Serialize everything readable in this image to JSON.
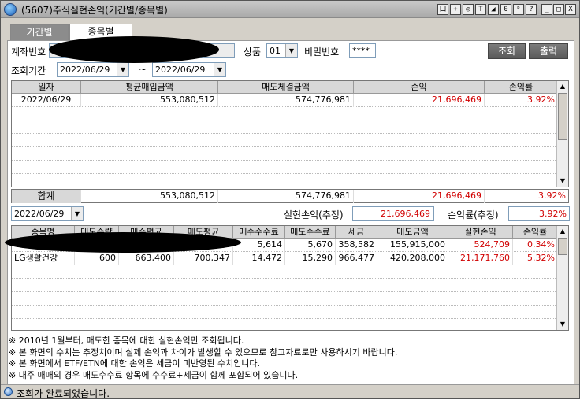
{
  "window": {
    "title": "(5607)주식실현손익(기간별/종목별)",
    "buttons": [
      "口",
      "+",
      "◎",
      "T",
      "◢",
      "0",
      "ᵖ",
      "?",
      "_",
      "□",
      "X"
    ]
  },
  "tabs": [
    {
      "label": "기간별"
    },
    {
      "label": "종목별"
    }
  ],
  "form": {
    "account_label": "계좌번호",
    "account_value": "",
    "product_label": "상품",
    "product_value": "01",
    "password_label": "비밀번호",
    "password_value": "****",
    "period_label": "조회기간",
    "start_date": "2022/06/29",
    "tilde": "~",
    "end_date": "2022/06/29",
    "query_button": "조회",
    "print_button": "출력"
  },
  "daily_table": {
    "headers": [
      "일자",
      "평균매입금액",
      "매도체결금액",
      "손익",
      "손익률"
    ],
    "rows": [
      [
        "2022/06/29",
        "553,080,512",
        "574,776,981",
        "21,696,469",
        "3.92%"
      ]
    ],
    "total_label": "합계",
    "total": [
      "553,080,512",
      "574,776,981",
      "21,696,469",
      "3.92%"
    ]
  },
  "summary": {
    "date": "2022/06/29",
    "realized_label": "실현손익(추정)",
    "realized_value": "21,696,469",
    "rate_label": "손익률(추정)",
    "rate_value": "3.92%"
  },
  "stock_table": {
    "headers": [
      "종목명",
      "매도수량",
      "매수평균",
      "매도평균",
      "매수수수료",
      "매도수수료",
      "세금",
      "매도금액",
      "실현손익",
      "손익률"
    ],
    "rows": [
      [
        "",
        "",
        "",
        "",
        "5,614",
        "5,670",
        "358,582",
        "155,915,000",
        "524,709",
        "0.34%"
      ],
      [
        "LG생활건강",
        "600",
        "663,400",
        "700,347",
        "14,472",
        "15,290",
        "966,477",
        "420,208,000",
        "21,171,760",
        "5.32%"
      ]
    ]
  },
  "notes": [
    "※ 2010년 1월부터, 매도한 종목에 대한 실현손익만 조회됩니다.",
    "※ 본 화면의 수치는 추정치이며 실제 손익과 차이가 발생할 수 있으므로 참고자료로만 사용하시기 바랍니다.",
    "※ 본 화면에서 ETF/ETN에 대한 손익은 세금이 미반영된 수치입니다.",
    "※ 대주 매매의 경우 매도수수료 항목에 수수료+세금이 함께 포함되어 있습니다."
  ],
  "status": {
    "text": "조회가 완료되었습니다."
  },
  "colors": {
    "profit": "#d10000",
    "header_bg": "#d8d8d8",
    "tab_inactive": "#8c8c8c"
  }
}
